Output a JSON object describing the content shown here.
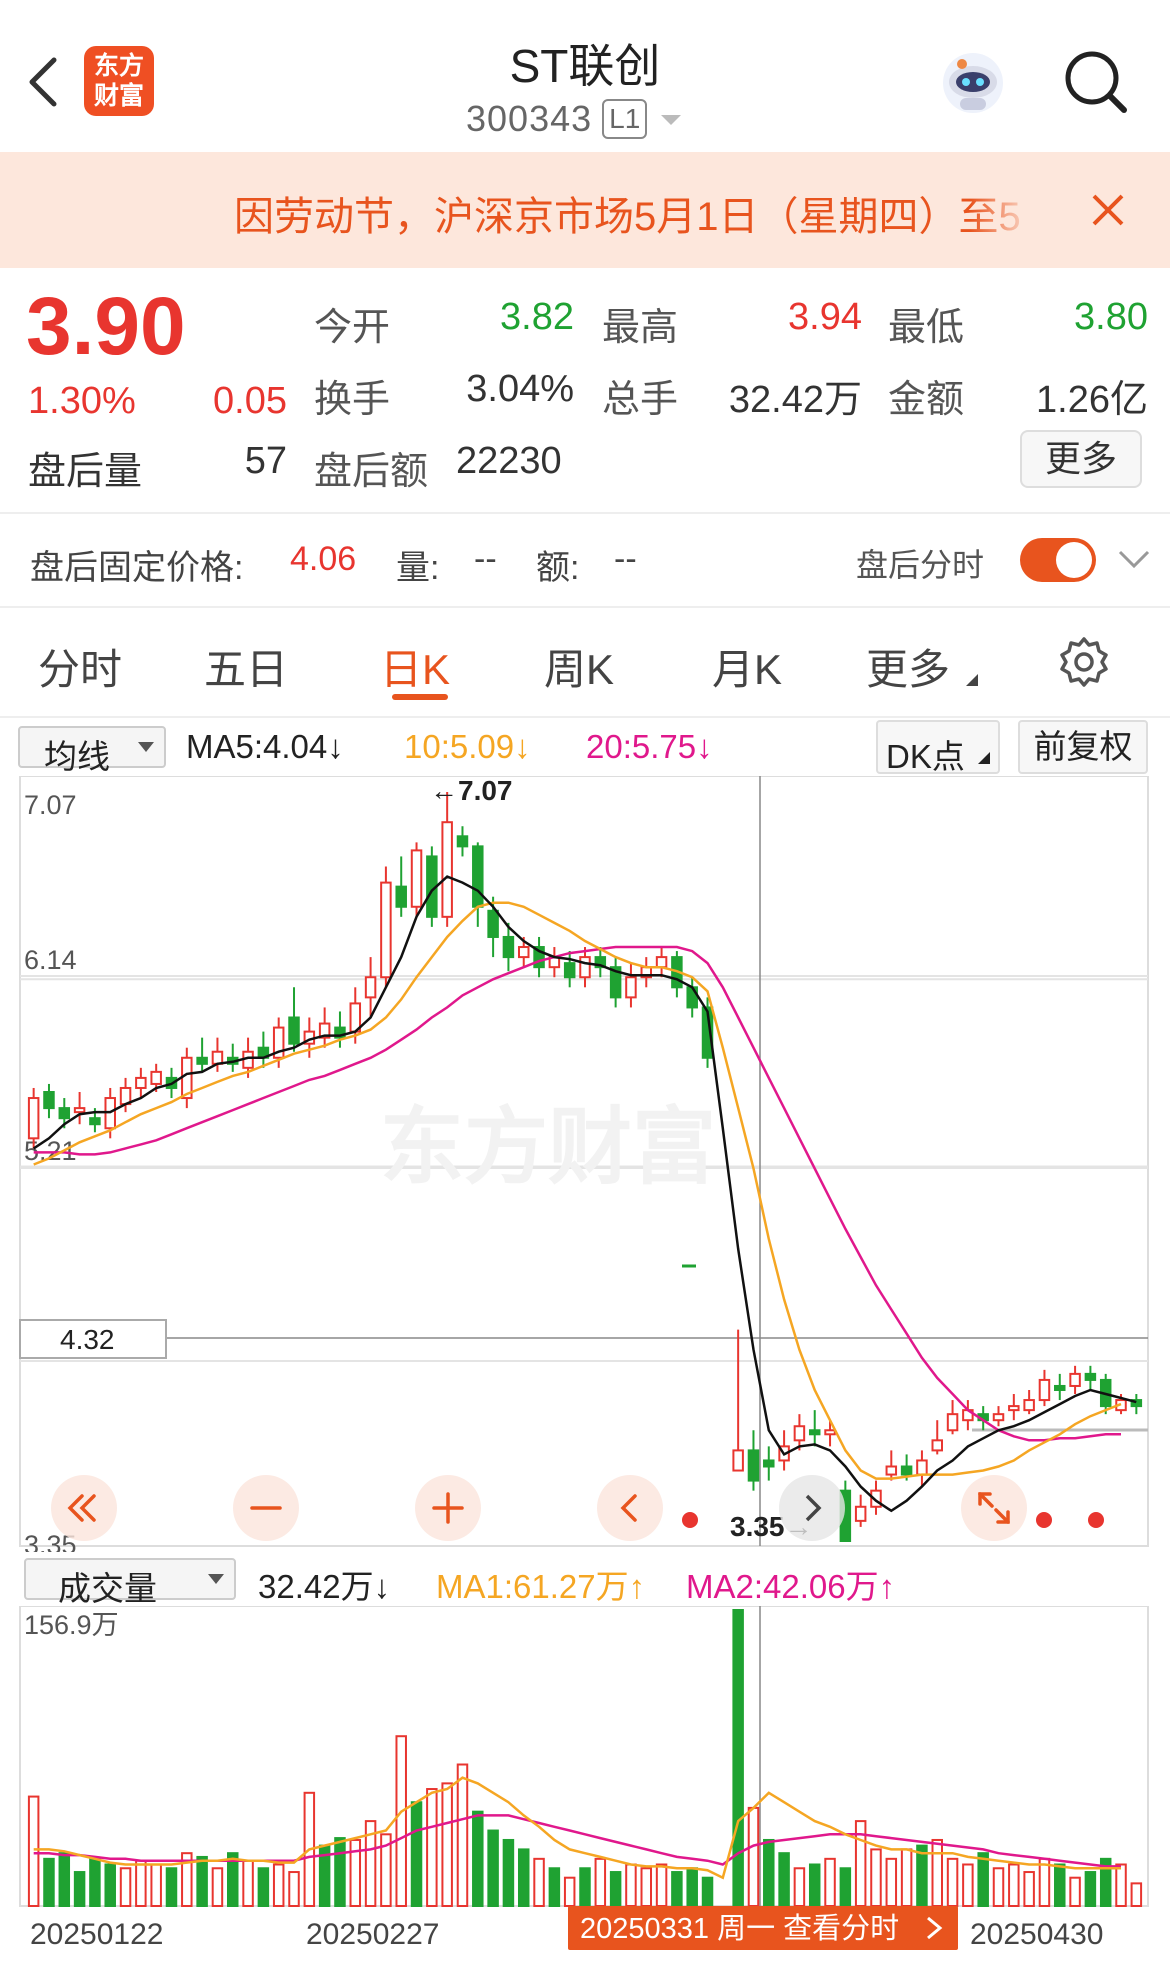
{
  "header": {
    "back_icon": "chevron-left-icon",
    "logo_text": "东方\n财富",
    "title": "ST联创",
    "code": "300343",
    "level_badge": "L1",
    "robot_icon": "robot-icon",
    "search_icon": "search-icon"
  },
  "notice": {
    "text": "因劳动节，沪深京市场5月1日（星期四）至5",
    "close_icon": "close-icon"
  },
  "quote": {
    "price": "3.90",
    "change_pct": "1.30%",
    "change": "0.05",
    "open_label": "今开",
    "open": "3.82",
    "high_label": "最高",
    "high": "3.94",
    "low_label": "最低",
    "low": "3.80",
    "turnover_label": "换手",
    "turnover": "3.04%",
    "volume_label": "总手",
    "volume": "32.42万",
    "amount_label": "金额",
    "amount": "1.26亿",
    "after_vol_label": "盘后量",
    "after_vol": "57",
    "after_amount_label": "盘后额",
    "after_amount": "22230",
    "more_button": "更多"
  },
  "after_hours": {
    "price_label": "盘后固定价格:",
    "price": "4.06",
    "vol_label": "量:",
    "vol": "--",
    "amt_label": "额:",
    "amt": "--",
    "toggle_label": "盘后分时",
    "toggle_on": true
  },
  "tabs": [
    {
      "label": "分时"
    },
    {
      "label": "五日"
    },
    {
      "label": "日K"
    },
    {
      "label": "周K"
    },
    {
      "label": "月K"
    },
    {
      "label": "更多"
    }
  ],
  "active_tab": "日K",
  "ma_bar": {
    "select": "均线",
    "ma5": "MA5:4.04↓",
    "ma10": "10:5.09↓",
    "ma20": "20:5.75↓",
    "dk_button": "DK点",
    "fq_button": "前复权"
  },
  "vol_bar": {
    "select": "成交量",
    "vol": "32.42万↓",
    "ma1": "MA1:61.27万↑",
    "ma2": "MA2:42.06万↑"
  },
  "colors": {
    "up": "#e8352f",
    "down": "#1fa232",
    "ma5": "#111111",
    "ma10": "#f5a623",
    "ma20": "#e0188c",
    "accent": "#e8541e"
  },
  "chart_data": {
    "type": "candlestick",
    "y_ticks": [
      "7.07",
      "6.14",
      "5.21",
      "4.32",
      "3.35"
    ],
    "ylim": [
      3.35,
      7.07
    ],
    "high_label": "←7.07",
    "low_label": "3.35→",
    "cursor_price": "4.32",
    "vol_max_label": "156.9万",
    "x_labels": [
      "20250122",
      "20250227",
      "20250430"
    ],
    "cursor_date_label": "20250331 周一 查看分时",
    "watermark": "东方财富",
    "candles": [
      [
        5.35,
        5.55,
        5.6,
        5.3
      ],
      [
        5.58,
        5.5,
        5.62,
        5.45
      ],
      [
        5.5,
        5.45,
        5.55,
        5.4
      ],
      [
        5.48,
        5.5,
        5.58,
        5.42
      ],
      [
        5.45,
        5.42,
        5.5,
        5.38
      ],
      [
        5.4,
        5.55,
        5.6,
        5.35
      ],
      [
        5.52,
        5.6,
        5.65,
        5.48
      ],
      [
        5.6,
        5.65,
        5.7,
        5.55
      ],
      [
        5.62,
        5.68,
        5.72,
        5.58
      ],
      [
        5.65,
        5.6,
        5.7,
        5.55
      ],
      [
        5.55,
        5.75,
        5.8,
        5.5
      ],
      [
        5.75,
        5.72,
        5.85,
        5.68
      ],
      [
        5.72,
        5.78,
        5.85,
        5.68
      ],
      [
        5.75,
        5.72,
        5.82,
        5.68
      ],
      [
        5.7,
        5.78,
        5.85,
        5.65
      ],
      [
        5.8,
        5.75,
        5.88,
        5.7
      ],
      [
        5.75,
        5.9,
        5.95,
        5.7
      ],
      [
        5.95,
        5.82,
        6.1,
        5.78
      ],
      [
        5.82,
        5.88,
        5.95,
        5.75
      ],
      [
        5.85,
        5.92,
        6.0,
        5.8
      ],
      [
        5.9,
        5.85,
        5.98,
        5.8
      ],
      [
        5.88,
        6.02,
        6.1,
        5.82
      ],
      [
        6.05,
        6.15,
        6.25,
        5.95
      ],
      [
        6.15,
        6.62,
        6.7,
        6.1
      ],
      [
        6.6,
        6.5,
        6.75,
        6.45
      ],
      [
        6.5,
        6.78,
        6.82,
        6.45
      ],
      [
        6.75,
        6.45,
        6.8,
        6.4
      ],
      [
        6.45,
        6.92,
        7.07,
        6.4
      ],
      [
        6.85,
        6.8,
        6.9,
        6.75
      ],
      [
        6.8,
        6.5,
        6.82,
        6.4
      ],
      [
        6.48,
        6.35,
        6.55,
        6.25
      ],
      [
        6.35,
        6.25,
        6.42,
        6.18
      ],
      [
        6.25,
        6.3,
        6.35,
        6.2
      ],
      [
        6.3,
        6.2,
        6.35,
        6.15
      ],
      [
        6.2,
        6.25,
        6.3,
        6.15
      ],
      [
        6.22,
        6.15,
        6.28,
        6.1
      ],
      [
        6.15,
        6.25,
        6.3,
        6.1
      ],
      [
        6.25,
        6.2,
        6.3,
        6.15
      ],
      [
        6.2,
        6.05,
        6.25,
        6.0
      ],
      [
        6.05,
        6.15,
        6.22,
        6.0
      ],
      [
        6.15,
        6.2,
        6.25,
        6.1
      ],
      [
        6.2,
        6.25,
        6.3,
        6.15
      ],
      [
        6.25,
        6.1,
        6.28,
        6.05
      ],
      [
        6.1,
        6.0,
        6.15,
        5.95
      ],
      [
        6.0,
        5.75,
        6.05,
        5.7
      ],
      [
        5.0,
        5.0,
        5.0,
        5.0
      ],
      [
        3.7,
        3.8,
        4.4,
        3.7
      ],
      [
        3.8,
        3.65,
        3.9,
        3.6
      ],
      [
        3.75,
        3.72,
        3.82,
        3.65
      ],
      [
        3.75,
        3.82,
        3.9,
        3.7
      ],
      [
        3.85,
        3.92,
        3.98,
        3.8
      ],
      [
        3.9,
        3.88,
        4.0,
        3.82
      ],
      [
        3.88,
        3.9,
        3.95,
        3.82
      ],
      [
        3.6,
        3.35,
        3.65,
        3.35
      ],
      [
        3.45,
        3.52,
        3.58,
        3.42
      ],
      [
        3.52,
        3.6,
        3.65,
        3.48
      ],
      [
        3.68,
        3.72,
        3.8,
        3.65
      ],
      [
        3.72,
        3.68,
        3.78,
        3.65
      ],
      [
        3.68,
        3.75,
        3.8,
        3.62
      ],
      [
        3.8,
        3.85,
        3.95,
        3.78
      ],
      [
        3.9,
        3.98,
        4.05,
        3.88
      ],
      [
        3.95,
        4.0,
        4.05,
        3.9
      ],
      [
        3.98,
        3.95,
        4.02,
        3.9
      ],
      [
        3.95,
        3.98,
        4.02,
        3.92
      ],
      [
        4.0,
        4.02,
        4.08,
        3.95
      ],
      [
        4.0,
        4.05,
        4.1,
        3.98
      ],
      [
        4.05,
        4.15,
        4.2,
        4.02
      ],
      [
        4.12,
        4.1,
        4.18,
        4.05
      ],
      [
        4.12,
        4.18,
        4.22,
        4.08
      ],
      [
        4.18,
        4.15,
        4.22,
        4.1
      ],
      [
        4.15,
        4.02,
        4.18,
        3.98
      ],
      [
        4.0,
        4.05,
        4.08,
        3.98
      ],
      [
        4.05,
        4.02,
        4.08,
        3.98
      ]
    ],
    "ma5": [
      5.3,
      5.35,
      5.42,
      5.47,
      5.48,
      5.48,
      5.52,
      5.55,
      5.6,
      5.62,
      5.67,
      5.68,
      5.72,
      5.73,
      5.75,
      5.75,
      5.78,
      5.8,
      5.84,
      5.86,
      5.86,
      5.88,
      5.95,
      6.1,
      6.25,
      6.45,
      6.58,
      6.65,
      6.62,
      6.58,
      6.5,
      6.4,
      6.33,
      6.28,
      6.25,
      6.24,
      6.22,
      6.21,
      6.18,
      6.16,
      6.16,
      6.16,
      6.14,
      6.1,
      5.98,
      5.4,
      4.8,
      4.3,
      3.9,
      3.78,
      3.82,
      3.83,
      3.8,
      3.72,
      3.62,
      3.55,
      3.5,
      3.55,
      3.62,
      3.7,
      3.75,
      3.82,
      3.86,
      3.9,
      3.92,
      3.95,
      3.99,
      4.03,
      4.07,
      4.1,
      4.08,
      4.06,
      4.04
    ],
    "ma10": [
      5.22,
      5.25,
      5.29,
      5.33,
      5.36,
      5.39,
      5.43,
      5.47,
      5.5,
      5.53,
      5.57,
      5.6,
      5.63,
      5.66,
      5.68,
      5.71,
      5.74,
      5.77,
      5.79,
      5.81,
      5.84,
      5.86,
      5.89,
      5.95,
      6.04,
      6.15,
      6.25,
      6.35,
      6.43,
      6.5,
      6.52,
      6.52,
      6.5,
      6.46,
      6.42,
      6.38,
      6.33,
      6.29,
      6.25,
      6.22,
      6.2,
      6.2,
      6.18,
      6.15,
      6.08,
      5.8,
      5.5,
      5.2,
      4.85,
      4.55,
      4.3,
      4.1,
      3.95,
      3.8,
      3.7,
      3.66,
      3.66,
      3.67,
      3.68,
      3.68,
      3.68,
      3.69,
      3.7,
      3.72,
      3.75,
      3.8,
      3.84,
      3.88,
      3.93,
      3.97,
      4.0,
      4.03,
      5.09
    ],
    "ma20": [
      5.28,
      5.28,
      5.28,
      5.27,
      5.27,
      5.28,
      5.3,
      5.32,
      5.34,
      5.37,
      5.4,
      5.43,
      5.46,
      5.49,
      5.52,
      5.55,
      5.58,
      5.61,
      5.64,
      5.66,
      5.69,
      5.72,
      5.75,
      5.79,
      5.84,
      5.89,
      5.95,
      6.0,
      6.06,
      6.1,
      6.14,
      6.17,
      6.2,
      6.23,
      6.25,
      6.27,
      6.28,
      6.29,
      6.3,
      6.3,
      6.3,
      6.3,
      6.3,
      6.28,
      6.22,
      6.1,
      5.95,
      5.8,
      5.65,
      5.5,
      5.35,
      5.2,
      5.05,
      4.9,
      4.76,
      4.62,
      4.5,
      4.38,
      4.26,
      4.16,
      4.08,
      4.0,
      3.95,
      3.9,
      3.87,
      3.85,
      3.85,
      3.86,
      3.86,
      3.87,
      3.88,
      3.88,
      5.75
    ],
    "volumes": [
      58,
      25,
      28,
      18,
      25,
      22,
      20,
      24,
      22,
      20,
      28,
      26,
      20,
      28,
      24,
      20,
      22,
      18,
      60,
      32,
      36,
      35,
      45,
      38,
      90,
      55,
      62,
      65,
      75,
      50,
      40,
      35,
      30,
      25,
      20,
      15,
      20,
      25,
      18,
      22,
      20,
      22,
      18,
      20,
      15,
      0,
      156.9,
      52,
      35,
      28,
      20,
      22,
      25,
      20,
      45,
      30,
      25,
      30,
      32,
      35,
      25,
      22,
      28,
      20,
      22,
      18,
      25,
      22,
      15,
      18,
      25,
      22,
      12
    ],
    "vol_up": [
      true,
      false,
      false,
      false,
      false,
      false,
      true,
      true,
      true,
      false,
      true,
      false,
      true,
      false,
      true,
      false,
      true,
      true,
      true,
      false,
      false,
      true,
      true,
      true,
      true,
      false,
      true,
      true,
      true,
      false,
      false,
      false,
      false,
      true,
      false,
      true,
      false,
      true,
      false,
      true,
      true,
      true,
      false,
      false,
      false,
      false,
      false,
      true,
      false,
      false,
      true,
      false,
      true,
      false,
      true,
      true,
      true,
      true,
      false,
      true,
      true,
      true,
      false,
      true,
      true,
      true,
      true,
      false,
      true,
      false,
      false,
      true,
      true
    ],
    "vol_ma1": [
      30,
      30,
      29,
      27,
      25,
      23,
      22,
      22,
      22,
      22,
      23,
      24,
      24,
      25,
      24,
      24,
      23,
      23,
      30,
      32,
      34,
      36,
      38,
      40,
      50,
      55,
      60,
      62,
      68,
      65,
      60,
      55,
      48,
      42,
      35,
      30,
      28,
      26,
      24,
      22,
      21,
      21,
      20,
      20,
      19,
      15,
      45,
      52,
      60,
      55,
      50,
      45,
      42,
      38,
      35,
      32,
      30,
      30,
      28,
      28,
      28,
      26,
      25,
      24,
      23,
      22,
      22,
      21,
      20,
      20,
      20,
      20,
      18
    ],
    "vol_ma2": [
      28,
      28,
      27,
      27,
      26,
      25,
      25,
      24,
      24,
      24,
      24,
      24,
      24,
      24,
      24,
      24,
      24,
      24,
      26,
      27,
      28,
      29,
      30,
      32,
      36,
      40,
      42,
      44,
      46,
      48,
      48,
      48,
      46,
      44,
      42,
      40,
      38,
      36,
      34,
      32,
      30,
      28,
      26,
      25,
      24,
      22,
      28,
      32,
      34,
      35,
      36,
      37,
      38,
      38,
      38,
      37,
      36,
      35,
      34,
      33,
      32,
      31,
      30,
      28,
      27,
      26,
      25,
      24,
      23,
      22,
      21,
      21,
      20
    ]
  }
}
